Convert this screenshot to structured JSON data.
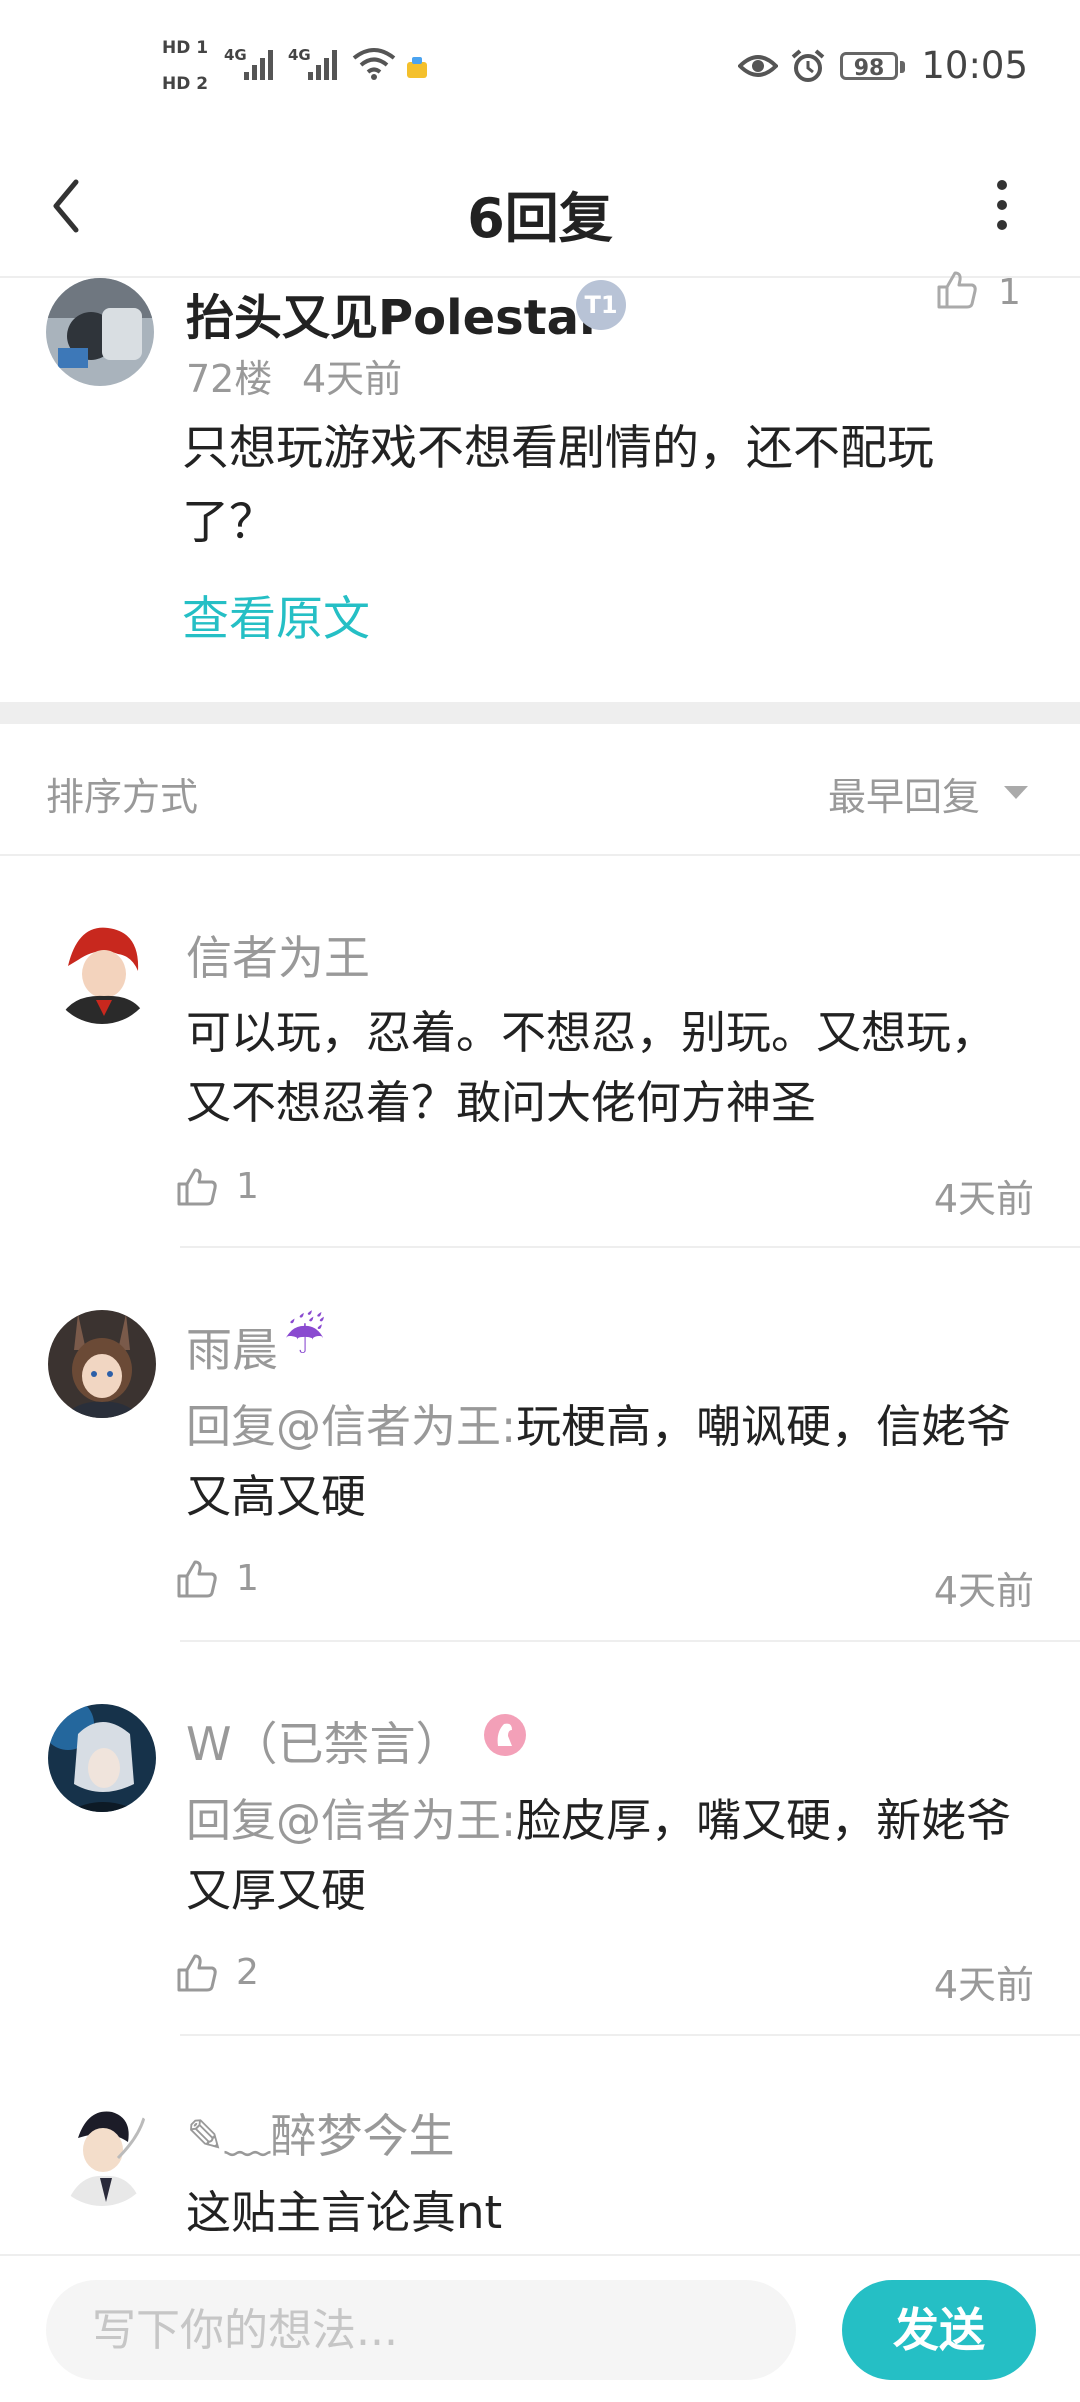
{
  "status_bar": {
    "hd1": "HD 1",
    "hd2": "HD 2",
    "network1": "4G",
    "network2": "4G",
    "battery": "98",
    "time": "10:05"
  },
  "header": {
    "title": "6回复"
  },
  "main_post": {
    "username": "抬头又见Polestar",
    "badge": "T1",
    "floor": "72楼",
    "time": "4天前",
    "like_count": "1",
    "content": "只想玩游戏不想看剧情的，还不配玩了？",
    "view_original": "查看原文"
  },
  "sort": {
    "label": "排序方式",
    "value": "最早回复"
  },
  "comments": [
    {
      "name": "信者为王",
      "content": "可以玩，忍着。不想忍，别玩。又想玩，又不想忍着？敢问大佬何方神圣",
      "likes": "1",
      "time": "4天前"
    },
    {
      "name": "雨晨",
      "emoji": "☔",
      "mention": "回复@信者为王:",
      "content": "玩梗高，嘲讽硬，信姥爷又高又硬",
      "likes": "1",
      "time": "4天前"
    },
    {
      "name": "W（已禁言）",
      "mention": "回复@信者为王:",
      "content": "脸皮厚，嘴又硬，新姥爷又厚又硬",
      "likes": "2",
      "time": "4天前"
    },
    {
      "name": "✎﹏醉梦今生",
      "content": "这贴主言论真nt"
    }
  ],
  "composer": {
    "placeholder": "写下你的想法...",
    "send": "发送"
  },
  "colors": {
    "accent": "#25bfc5",
    "muted_text": "#999999",
    "divider": "#eeeeee"
  }
}
